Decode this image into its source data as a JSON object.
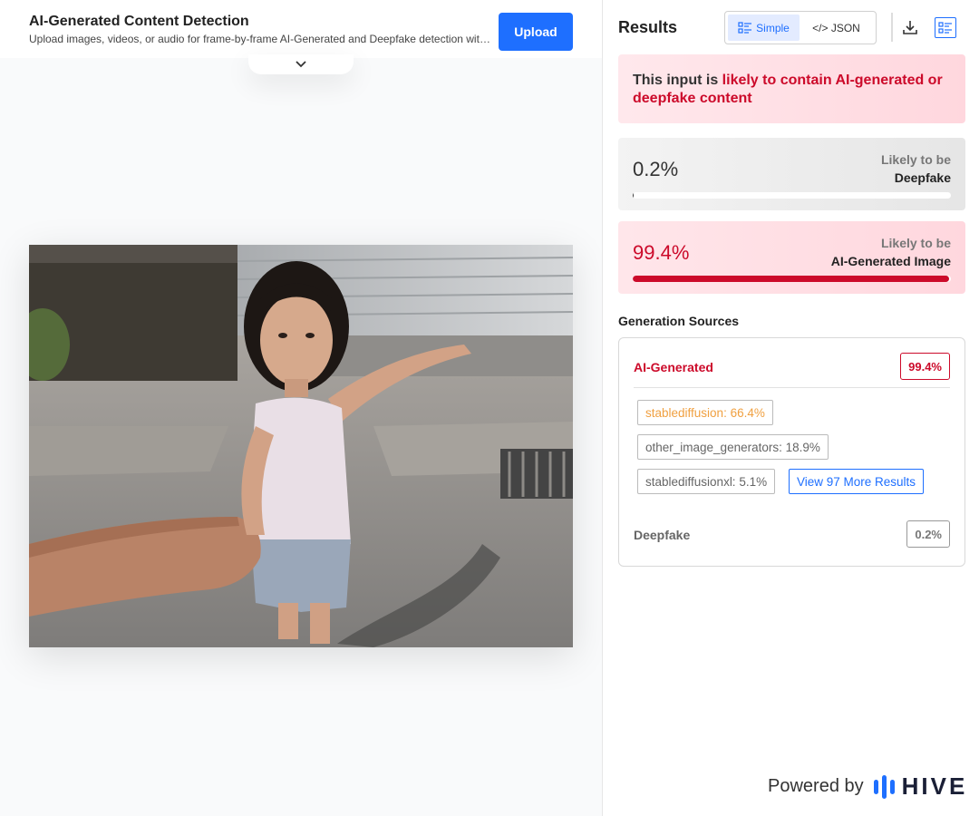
{
  "header": {
    "title": "AI-Generated Content Detection",
    "subtitle": "Upload images, videos, or audio for frame-by-frame AI-Generated and Deepfake detection with...",
    "upload_label": "Upload"
  },
  "results": {
    "title": "Results",
    "view_simple": "Simple",
    "view_json": "</> JSON",
    "verdict_prefix": "This input is ",
    "verdict_highlight": "likely to contain AI-generated or deepfake content"
  },
  "scores": {
    "deepfake": {
      "value": "0.2%",
      "fraction": 0.002,
      "label_top": "Likely to be",
      "label_bottom": "Deepfake"
    },
    "ai_generated": {
      "value": "99.4%",
      "fraction": 0.994,
      "label_top": "Likely to be",
      "label_bottom": "AI-Generated Image"
    }
  },
  "sources": {
    "title": "Generation Sources",
    "ai_heading": "AI-Generated",
    "ai_value": "99.4%",
    "chips": [
      "stablediffusion: 66.4%",
      "other_image_generators: 18.9%",
      "stablediffusionxl: 5.1%"
    ],
    "more_label": "View 97 More Results",
    "deepfake_heading": "Deepfake",
    "deepfake_value": "0.2%"
  },
  "footer": {
    "powered_by": "Powered by",
    "brand": "HIVE"
  },
  "colors": {
    "accent": "#1e6fff",
    "danger": "#cc0a2a",
    "warning_chip": "#f0a040"
  }
}
